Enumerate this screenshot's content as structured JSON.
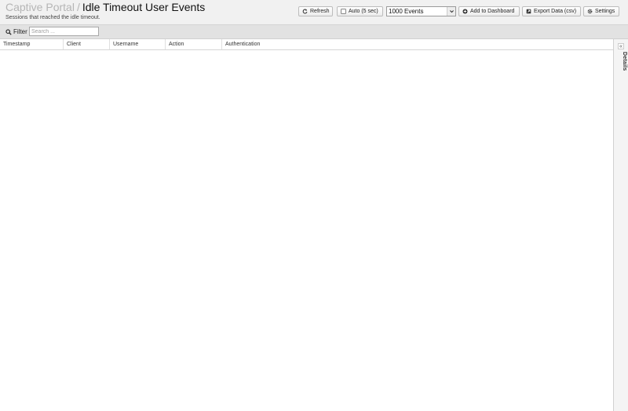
{
  "header": {
    "breadcrumb_parent": "Captive Portal",
    "separator": "/",
    "title": "Idle Timeout User Events",
    "subtitle": "Sessions that reached the idle timeout."
  },
  "toolbar": {
    "refresh_label": "Refresh",
    "auto_label": "Auto (5 sec)",
    "events_select_value": "1000 Events",
    "add_dashboard_label": "Add to Dashboard",
    "export_label": "Export Data (csv)",
    "settings_label": "Settings"
  },
  "filter": {
    "label": "Filter",
    "placeholder": "Search ..."
  },
  "table": {
    "columns": [
      "Timestamp",
      "Client",
      "Username",
      "Action",
      "Authentication"
    ],
    "rows": []
  },
  "details": {
    "label": "Details",
    "toggle_glyph": "«"
  },
  "icons": {
    "refresh": "refresh-icon",
    "checkbox": "checkbox-icon",
    "add": "plus-circle-icon",
    "export": "export-icon",
    "settings": "gear-icon",
    "search": "search-icon",
    "select_caret": "chevron-down-icon"
  }
}
